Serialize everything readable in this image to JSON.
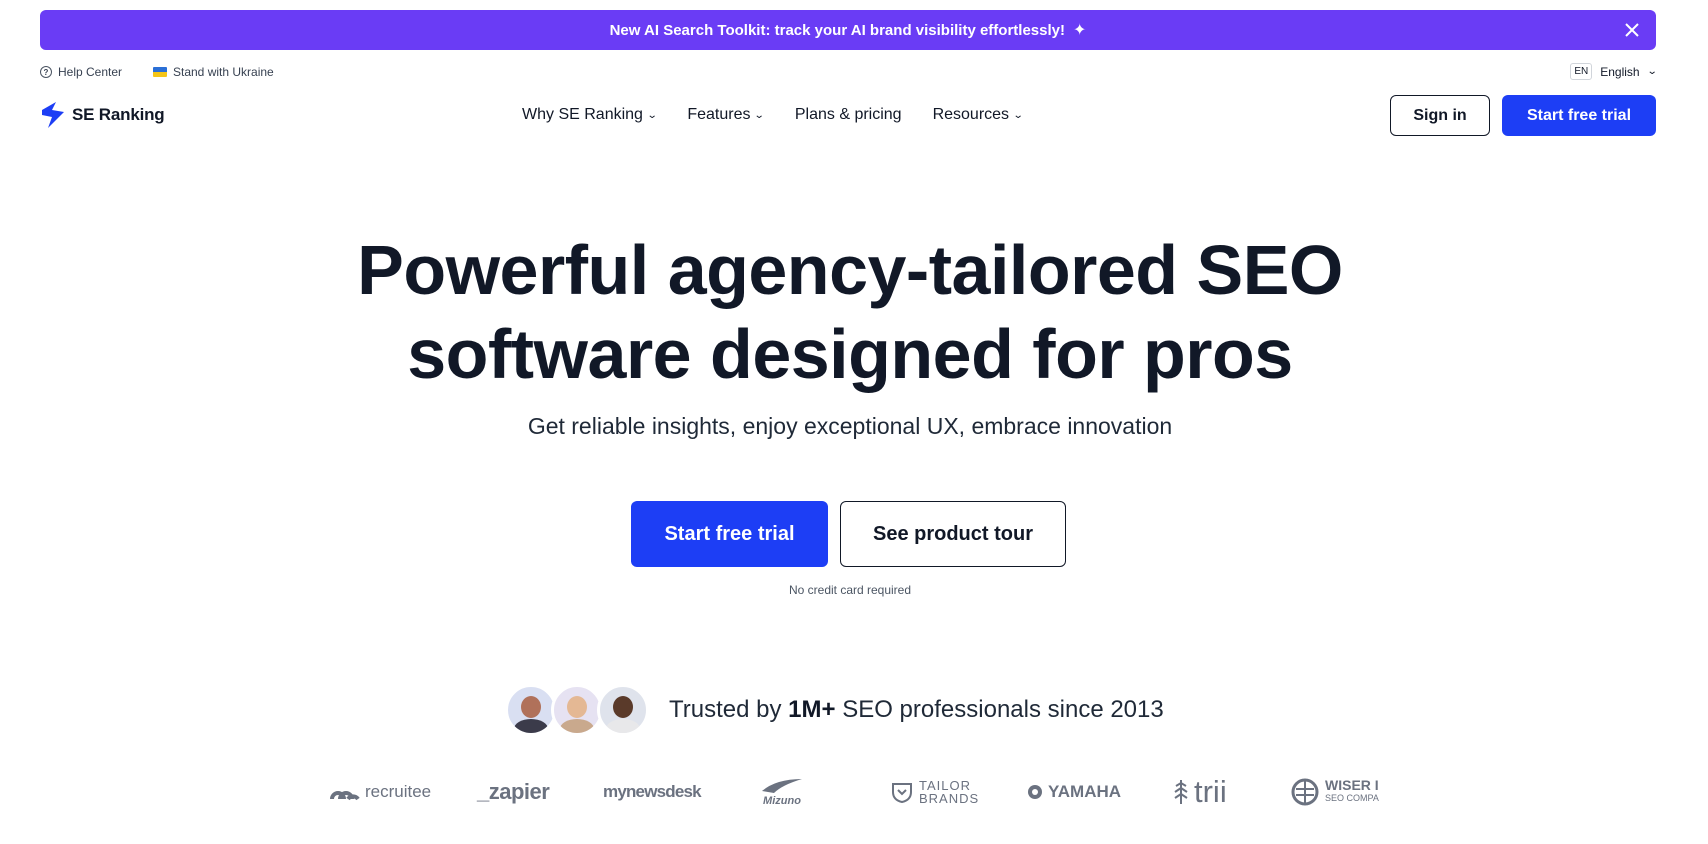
{
  "banner": {
    "text": "New AI Search Toolkit: track your AI brand visibility effortlessly!",
    "bg_color": "#6a3cf5"
  },
  "utility": {
    "help_center": "Help Center",
    "ukraine": "Stand with Ukraine",
    "lang_code": "EN",
    "lang_label": "English"
  },
  "nav": {
    "logo_text": "SE Ranking",
    "menu": [
      "Why SE Ranking",
      "Features",
      "Plans & pricing",
      "Resources"
    ],
    "sign_in": "Sign in",
    "start_trial": "Start free trial"
  },
  "hero": {
    "title_line1": "Powerful agency-tailored SEO",
    "title_line2": "software designed for pros",
    "subtitle": "Get reliable insights, enjoy exceptional UX, embrace innovation",
    "primary_cta": "Start free trial",
    "secondary_cta": "See product tour",
    "note": "No credit card required"
  },
  "trusted": {
    "prefix": "Trusted by",
    "highlight": "1M+",
    "suffix": "SEO professionals since 2013"
  },
  "brands": [
    "recruitee",
    "_zapier",
    "mynewsdesk",
    "Mizuno",
    "TAILOR",
    "BRANDS",
    "YAMAHA",
    "trii",
    "WISER I",
    "SEO COMPA"
  ],
  "colors": {
    "accent": "#1d3ef5",
    "text": "#111827"
  }
}
